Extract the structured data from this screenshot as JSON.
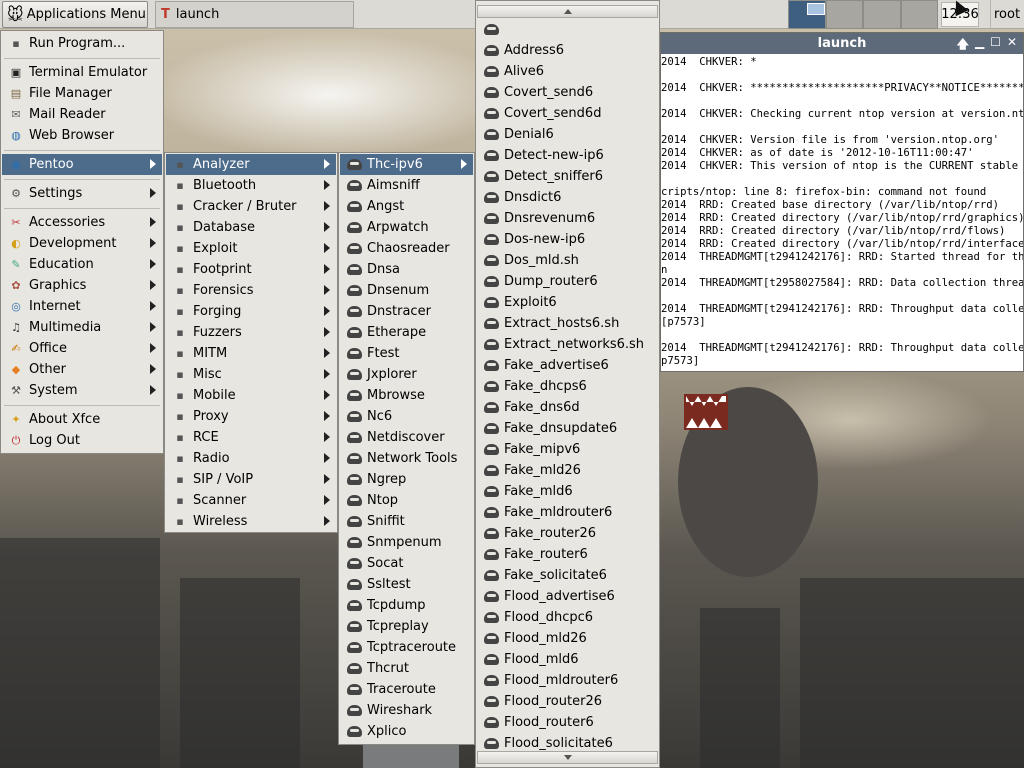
{
  "panel": {
    "app_menu_label": "Applications Menu",
    "task_label": "launch",
    "clock": "12:36",
    "user": "root"
  },
  "terminal": {
    "title": "launch",
    "lines": [
      "2014  CHKVER: *",
      "",
      "2014  CHKVER: *********************PRIVACY**NOTICE*********",
      "",
      "2014  CHKVER: Checking current ntop version at version.ntop.",
      "",
      "2014  CHKVER: Version file is from 'version.ntop.org'",
      "2014  CHKVER: as of date is '2012-10-16T11:00:47'",
      "2014  CHKVER: This version of ntop is the CURRENT stable ver",
      "",
      "cripts/ntop: line 8: firefox-bin: command not found",
      "2014  RRD: Created base directory (/var/lib/ntop/rrd)",
      "2014  RRD: Created directory (/var/lib/ntop/rrd/graphics)",
      "2014  RRD: Created directory (/var/lib/ntop/rrd/flows)",
      "2014  RRD: Created directory (/var/lib/ntop/rrd/interfaces)",
      "2014  THREADMGMT[t2941242176]: RRD: Started thread for throu",
      "n",
      "2014  THREADMGMT[t2958027584]: RRD: Data collection thread r",
      "",
      "2014  THREADMGMT[t2941242176]: RRD: Throughput data collecti",
      "[p7573]",
      "",
      "2014  THREADMGMT[t2941242176]: RRD: Throughput data collecti",
      "p7573]"
    ]
  },
  "main_menu": {
    "items": [
      {
        "label": "Run Program...",
        "icon": "run-icon"
      },
      {
        "label": "Terminal Emulator",
        "icon": "terminal-icon"
      },
      {
        "label": "File Manager",
        "icon": "folder-icon"
      },
      {
        "label": "Mail Reader",
        "icon": "mail-icon"
      },
      {
        "label": "Web Browser",
        "icon": "globe-icon"
      },
      {
        "label": "Pentoo",
        "icon": "pentoo-icon"
      },
      {
        "label": "Settings",
        "icon": "settings-icon"
      },
      {
        "label": "Accessories",
        "icon": "accessories-icon"
      },
      {
        "label": "Development",
        "icon": "development-icon"
      },
      {
        "label": "Education",
        "icon": "education-icon"
      },
      {
        "label": "Graphics",
        "icon": "graphics-icon"
      },
      {
        "label": "Internet",
        "icon": "internet-icon"
      },
      {
        "label": "Multimedia",
        "icon": "multimedia-icon"
      },
      {
        "label": "Office",
        "icon": "office-icon"
      },
      {
        "label": "Other",
        "icon": "other-icon"
      },
      {
        "label": "System",
        "icon": "system-icon"
      },
      {
        "label": "About Xfce",
        "icon": "star-icon"
      },
      {
        "label": "Log Out",
        "icon": "logout-icon"
      }
    ]
  },
  "pentoo_menu": {
    "items": [
      "Analyzer",
      "Bluetooth",
      "Cracker / Bruter",
      "Database",
      "Exploit",
      "Footprint",
      "Forensics",
      "Forging",
      "Fuzzers",
      "MITM",
      "Misc",
      "Mobile",
      "Proxy",
      "RCE",
      "Radio",
      "SIP / VoIP",
      "Scanner",
      "Wireless"
    ]
  },
  "analyzer_menu": {
    "items": [
      "Thc-ipv6",
      "Aimsniff",
      "Angst",
      "Arpwatch",
      "Chaosreader",
      "Dnsa",
      "Dnsenum",
      "Dnstracer",
      "Etherape",
      "Ftest",
      "Jxplorer",
      "Mbrowse",
      "Nc6",
      "Netdiscover",
      "Network Tools",
      "Ngrep",
      "Ntop",
      "Sniffit",
      "Snmpenum",
      "Socat",
      "Ssltest",
      "Tcpdump",
      "Tcpreplay",
      "Tcptraceroute",
      "Thcrut",
      "Traceroute",
      "Wireshark",
      "Xplico"
    ]
  },
  "thc_menu": {
    "items": [
      "",
      "Address6",
      "Alive6",
      "Covert_send6",
      "Covert_send6d",
      "Denial6",
      "Detect-new-ip6",
      "Detect_sniffer6",
      "Dnsdict6",
      "Dnsrevenum6",
      "Dos-new-ip6",
      "Dos_mld.sh",
      "Dump_router6",
      "Exploit6",
      "Extract_hosts6.sh",
      "Extract_networks6.sh",
      "Fake_advertise6",
      "Fake_dhcps6",
      "Fake_dns6d",
      "Fake_dnsupdate6",
      "Fake_mipv6",
      "Fake_mld26",
      "Fake_mld6",
      "Fake_mldrouter6",
      "Fake_router26",
      "Fake_router6",
      "Fake_solicitate6",
      "Flood_advertise6",
      "Flood_dhcpc6",
      "Flood_mld26",
      "Flood_mld6",
      "Flood_mldrouter6",
      "Flood_router26",
      "Flood_router6",
      "Flood_solicitate6"
    ]
  },
  "colors": {
    "selection": "#4d6b8a",
    "menu_bg": "#e8e6e1",
    "terminal_title": "#5d6a79"
  }
}
